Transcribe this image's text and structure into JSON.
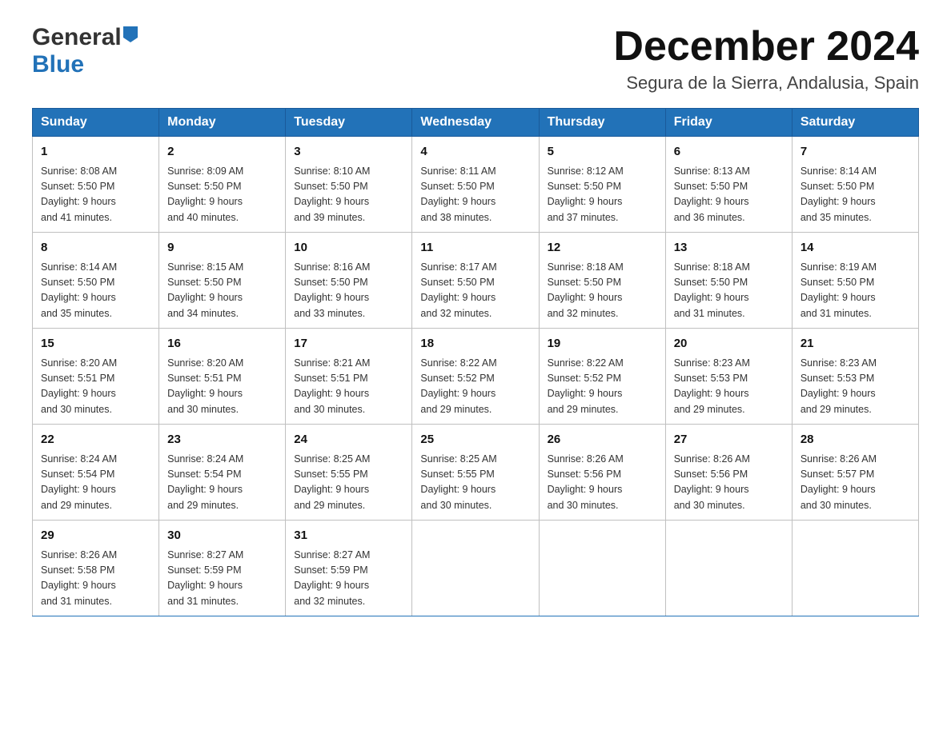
{
  "header": {
    "logo_general": "General",
    "logo_blue": "Blue",
    "month_title": "December 2024",
    "location": "Segura de la Sierra, Andalusia, Spain"
  },
  "days_of_week": [
    "Sunday",
    "Monday",
    "Tuesday",
    "Wednesday",
    "Thursday",
    "Friday",
    "Saturday"
  ],
  "weeks": [
    [
      {
        "day": "1",
        "sunrise": "8:08 AM",
        "sunset": "5:50 PM",
        "daylight": "9 hours and 41 minutes."
      },
      {
        "day": "2",
        "sunrise": "8:09 AM",
        "sunset": "5:50 PM",
        "daylight": "9 hours and 40 minutes."
      },
      {
        "day": "3",
        "sunrise": "8:10 AM",
        "sunset": "5:50 PM",
        "daylight": "9 hours and 39 minutes."
      },
      {
        "day": "4",
        "sunrise": "8:11 AM",
        "sunset": "5:50 PM",
        "daylight": "9 hours and 38 minutes."
      },
      {
        "day": "5",
        "sunrise": "8:12 AM",
        "sunset": "5:50 PM",
        "daylight": "9 hours and 37 minutes."
      },
      {
        "day": "6",
        "sunrise": "8:13 AM",
        "sunset": "5:50 PM",
        "daylight": "9 hours and 36 minutes."
      },
      {
        "day": "7",
        "sunrise": "8:14 AM",
        "sunset": "5:50 PM",
        "daylight": "9 hours and 35 minutes."
      }
    ],
    [
      {
        "day": "8",
        "sunrise": "8:14 AM",
        "sunset": "5:50 PM",
        "daylight": "9 hours and 35 minutes."
      },
      {
        "day": "9",
        "sunrise": "8:15 AM",
        "sunset": "5:50 PM",
        "daylight": "9 hours and 34 minutes."
      },
      {
        "day": "10",
        "sunrise": "8:16 AM",
        "sunset": "5:50 PM",
        "daylight": "9 hours and 33 minutes."
      },
      {
        "day": "11",
        "sunrise": "8:17 AM",
        "sunset": "5:50 PM",
        "daylight": "9 hours and 32 minutes."
      },
      {
        "day": "12",
        "sunrise": "8:18 AM",
        "sunset": "5:50 PM",
        "daylight": "9 hours and 32 minutes."
      },
      {
        "day": "13",
        "sunrise": "8:18 AM",
        "sunset": "5:50 PM",
        "daylight": "9 hours and 31 minutes."
      },
      {
        "day": "14",
        "sunrise": "8:19 AM",
        "sunset": "5:50 PM",
        "daylight": "9 hours and 31 minutes."
      }
    ],
    [
      {
        "day": "15",
        "sunrise": "8:20 AM",
        "sunset": "5:51 PM",
        "daylight": "9 hours and 30 minutes."
      },
      {
        "day": "16",
        "sunrise": "8:20 AM",
        "sunset": "5:51 PM",
        "daylight": "9 hours and 30 minutes."
      },
      {
        "day": "17",
        "sunrise": "8:21 AM",
        "sunset": "5:51 PM",
        "daylight": "9 hours and 30 minutes."
      },
      {
        "day": "18",
        "sunrise": "8:22 AM",
        "sunset": "5:52 PM",
        "daylight": "9 hours and 29 minutes."
      },
      {
        "day": "19",
        "sunrise": "8:22 AM",
        "sunset": "5:52 PM",
        "daylight": "9 hours and 29 minutes."
      },
      {
        "day": "20",
        "sunrise": "8:23 AM",
        "sunset": "5:53 PM",
        "daylight": "9 hours and 29 minutes."
      },
      {
        "day": "21",
        "sunrise": "8:23 AM",
        "sunset": "5:53 PM",
        "daylight": "9 hours and 29 minutes."
      }
    ],
    [
      {
        "day": "22",
        "sunrise": "8:24 AM",
        "sunset": "5:54 PM",
        "daylight": "9 hours and 29 minutes."
      },
      {
        "day": "23",
        "sunrise": "8:24 AM",
        "sunset": "5:54 PM",
        "daylight": "9 hours and 29 minutes."
      },
      {
        "day": "24",
        "sunrise": "8:25 AM",
        "sunset": "5:55 PM",
        "daylight": "9 hours and 29 minutes."
      },
      {
        "day": "25",
        "sunrise": "8:25 AM",
        "sunset": "5:55 PM",
        "daylight": "9 hours and 30 minutes."
      },
      {
        "day": "26",
        "sunrise": "8:26 AM",
        "sunset": "5:56 PM",
        "daylight": "9 hours and 30 minutes."
      },
      {
        "day": "27",
        "sunrise": "8:26 AM",
        "sunset": "5:56 PM",
        "daylight": "9 hours and 30 minutes."
      },
      {
        "day": "28",
        "sunrise": "8:26 AM",
        "sunset": "5:57 PM",
        "daylight": "9 hours and 30 minutes."
      }
    ],
    [
      {
        "day": "29",
        "sunrise": "8:26 AM",
        "sunset": "5:58 PM",
        "daylight": "9 hours and 31 minutes."
      },
      {
        "day": "30",
        "sunrise": "8:27 AM",
        "sunset": "5:59 PM",
        "daylight": "9 hours and 31 minutes."
      },
      {
        "day": "31",
        "sunrise": "8:27 AM",
        "sunset": "5:59 PM",
        "daylight": "9 hours and 32 minutes."
      },
      null,
      null,
      null,
      null
    ]
  ],
  "labels": {
    "sunrise": "Sunrise:",
    "sunset": "Sunset:",
    "daylight": "Daylight:"
  }
}
